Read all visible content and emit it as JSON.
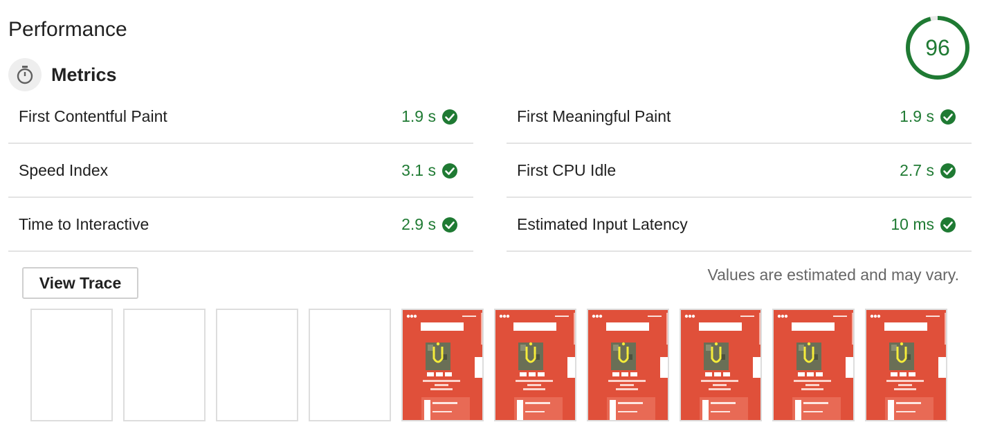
{
  "section": {
    "title": "Performance",
    "score": "96",
    "score_fraction": 0.96,
    "score_color": "#1f7a33"
  },
  "metrics_header": {
    "title": "Metrics",
    "icon": "stopwatch-icon"
  },
  "metrics": [
    {
      "label": "First Contentful Paint",
      "value": "1.9 s",
      "status": "pass"
    },
    {
      "label": "First Meaningful Paint",
      "value": "1.9 s",
      "status": "pass"
    },
    {
      "label": "Speed Index",
      "value": "3.1 s",
      "status": "pass"
    },
    {
      "label": "First CPU Idle",
      "value": "2.7 s",
      "status": "pass"
    },
    {
      "label": "Time to Interactive",
      "value": "2.9 s",
      "status": "pass"
    },
    {
      "label": "Estimated Input Latency",
      "value": "10 ms",
      "status": "pass"
    }
  ],
  "actions": {
    "view_trace": "View Trace"
  },
  "disclaimer": "Values are estimated and may vary.",
  "filmstrip": {
    "frames": [
      {
        "state": "blank"
      },
      {
        "state": "blank"
      },
      {
        "state": "blank"
      },
      {
        "state": "blank"
      },
      {
        "state": "painted"
      },
      {
        "state": "painted"
      },
      {
        "state": "painted"
      },
      {
        "state": "painted"
      },
      {
        "state": "painted"
      },
      {
        "state": "painted"
      }
    ],
    "accent_color": "#e0503a"
  }
}
